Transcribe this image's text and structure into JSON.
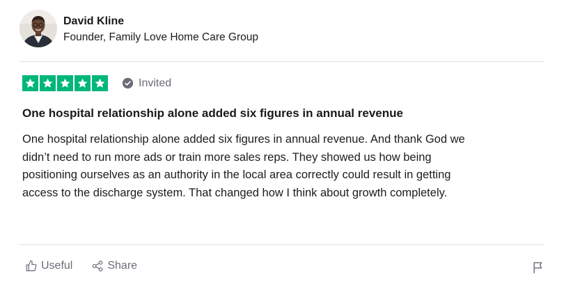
{
  "reviewer": {
    "name": "David Kline",
    "title": "Founder, Family Love Home Care Group"
  },
  "rating": {
    "stars": 5,
    "max_stars": 5,
    "star_color": "#00b67a",
    "verification_label": "Invited",
    "verification_icon": "check-circle-icon"
  },
  "review": {
    "title": "One hospital relationship alone added six figures in annual revenue",
    "body_lines": [
      "One hospital relationship alone added six figures in annual revenue. And thank God we",
      "didn’t need to run more ads or train more sales reps. They showed us how being",
      "positioning ourselves as an authority in the local area correctly could result in getting",
      "access to the discharge system. That changed how I think about growth completely."
    ]
  },
  "actions": {
    "useful_label": "Useful",
    "useful_icon": "thumbs-up-icon",
    "share_label": "Share",
    "share_icon": "share-icon",
    "report_icon": "flag-icon"
  },
  "colors": {
    "muted_text": "#6b6b78",
    "divider": "#dcdce6"
  }
}
